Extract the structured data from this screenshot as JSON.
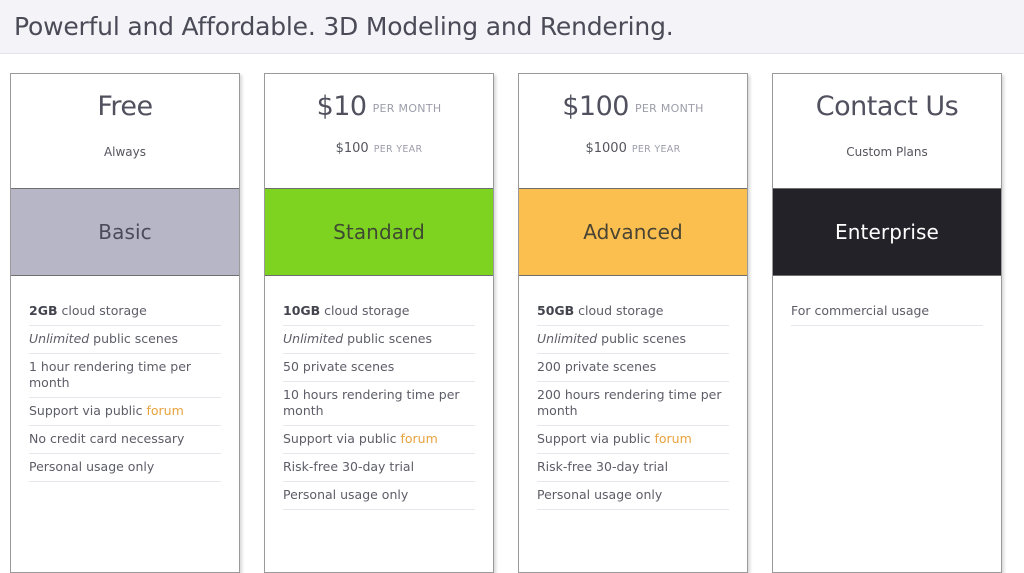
{
  "banner": {
    "headline": "Powerful and Affordable. 3D Modeling and Rendering."
  },
  "colors": {
    "banner_background": "#f4f3f8",
    "page_background": "#ffffff",
    "basic_band": "#b6b6c6",
    "standard_band": "#7ed321",
    "advanced_band": "#fbbf4f",
    "enterprise_band": "#222228",
    "link_accent": "#e8a33d",
    "text_primary": "#4a4a58",
    "text_muted": "#9d9daa"
  },
  "plans": [
    {
      "id": "basic",
      "price_amount": "Free",
      "price_period": "",
      "secondary_text": "Always",
      "secondary_amount": "",
      "secondary_period": "",
      "name": "Basic",
      "band_color": "#b6b6c6",
      "band_text_color": "#4a4a58",
      "features": [
        {
          "strong": "2GB",
          "italic": "",
          "text": " cloud storage",
          "link": ""
        },
        {
          "strong": "",
          "italic": "Unlimited",
          "text": " public scenes",
          "link": ""
        },
        {
          "strong": "",
          "italic": "",
          "text": "1 hour rendering time per month",
          "link": ""
        },
        {
          "strong": "",
          "italic": "",
          "text": "Support via public ",
          "link": "forum"
        },
        {
          "strong": "",
          "italic": "",
          "text": "No credit card necessary",
          "link": ""
        },
        {
          "strong": "",
          "italic": "",
          "text": "Personal usage only",
          "link": ""
        }
      ]
    },
    {
      "id": "standard",
      "price_amount": "$10",
      "price_period": "PER MONTH",
      "secondary_text": "",
      "secondary_amount": "$100",
      "secondary_period": "PER YEAR",
      "name": "Standard",
      "band_color": "#7ed321",
      "band_text_color": "#3f4a32",
      "features": [
        {
          "strong": "10GB",
          "italic": "",
          "text": " cloud storage",
          "link": ""
        },
        {
          "strong": "",
          "italic": "Unlimited",
          "text": " public scenes",
          "link": ""
        },
        {
          "strong": "",
          "italic": "",
          "text": "50 private scenes",
          "link": ""
        },
        {
          "strong": "",
          "italic": "",
          "text": "10 hours rendering time per month",
          "link": ""
        },
        {
          "strong": "",
          "italic": "",
          "text": "Support via public ",
          "link": "forum"
        },
        {
          "strong": "",
          "italic": "",
          "text": "Risk-free 30-day trial",
          "link": ""
        },
        {
          "strong": "",
          "italic": "",
          "text": "Personal usage only",
          "link": ""
        }
      ]
    },
    {
      "id": "advanced",
      "price_amount": "$100",
      "price_period": "PER MONTH",
      "secondary_text": "",
      "secondary_amount": "$1000",
      "secondary_period": "PER YEAR",
      "name": "Advanced",
      "band_color": "#fbbf4f",
      "band_text_color": "#4a4434",
      "features": [
        {
          "strong": "50GB",
          "italic": "",
          "text": " cloud storage",
          "link": ""
        },
        {
          "strong": "",
          "italic": "Unlimited",
          "text": " public scenes",
          "link": ""
        },
        {
          "strong": "",
          "italic": "",
          "text": "200 private scenes",
          "link": ""
        },
        {
          "strong": "",
          "italic": "",
          "text": "200 hours rendering time per month",
          "link": ""
        },
        {
          "strong": "",
          "italic": "",
          "text": "Support via public ",
          "link": "forum"
        },
        {
          "strong": "",
          "italic": "",
          "text": "Risk-free 30-day trial",
          "link": ""
        },
        {
          "strong": "",
          "italic": "",
          "text": "Personal usage only",
          "link": ""
        }
      ]
    },
    {
      "id": "enterprise",
      "price_amount": "Contact Us",
      "price_period": "",
      "secondary_text": "Custom Plans",
      "secondary_amount": "",
      "secondary_period": "",
      "name": "Enterprise",
      "band_color": "#222228",
      "band_text_color": "#ffffff",
      "features": [
        {
          "strong": "",
          "italic": "",
          "text": "For commercial usage",
          "link": ""
        }
      ]
    }
  ]
}
